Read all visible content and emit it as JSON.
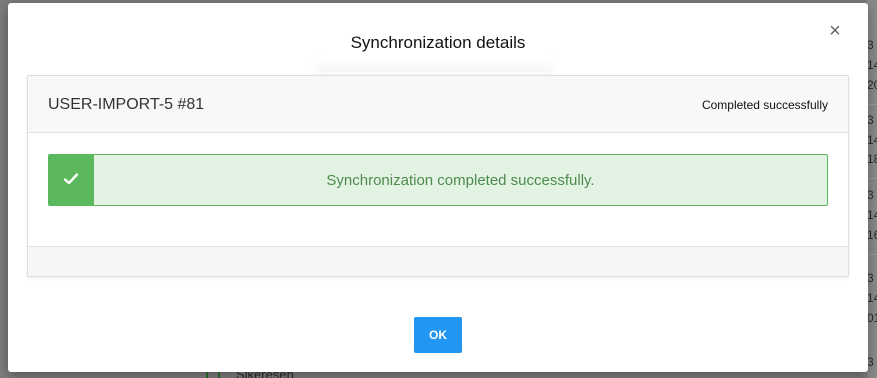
{
  "modal": {
    "title": "Synchronization details",
    "close_glyph": "×",
    "panel": {
      "name": "USER-IMPORT-5 #81",
      "status": "Completed successfully",
      "alert": {
        "icon": "check-icon",
        "message": "Synchronization completed successfully.",
        "color": "#5cb85c"
      }
    },
    "ok_label": "OK",
    "ok_color": "#2196f3"
  },
  "background": {
    "right_fragments": [
      "3",
      "14",
      "20",
      "3",
      "14",
      "18",
      "3",
      "14",
      "16",
      "3",
      "14",
      "01",
      "3"
    ],
    "bottom_text": "Sikeresen"
  }
}
